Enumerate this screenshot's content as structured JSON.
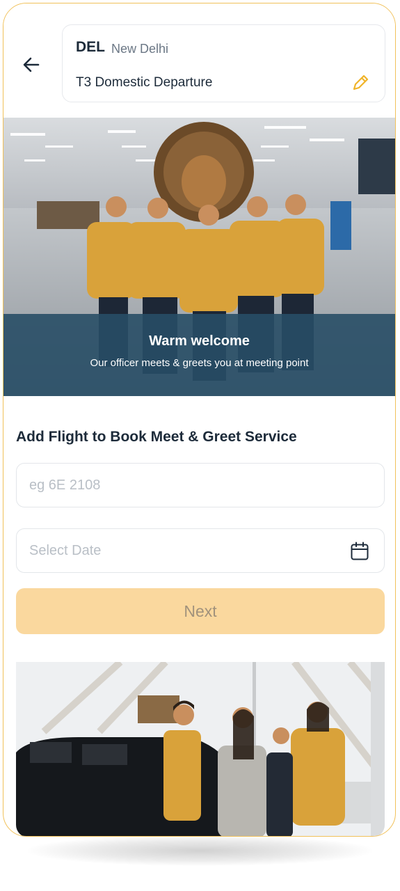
{
  "header": {
    "airport_code": "DEL",
    "city": "New Delhi",
    "terminal": "T3 Domestic Departure"
  },
  "hero": {
    "title": "Warm welcome",
    "subtitle": "Our officer meets & greets you at meeting point"
  },
  "form": {
    "title": "Add Flight to Book Meet & Greet Service",
    "flight_placeholder": "eg 6E 2108",
    "date_placeholder": "Select Date",
    "next_label": "Next"
  },
  "colors": {
    "accent": "#F1C15A",
    "button_disabled_bg": "#FAD89E",
    "caption_overlay": "#284E66",
    "text_dark": "#1D2B3A"
  },
  "icons": {
    "back": "arrow-left-icon",
    "edit": "pencil-icon",
    "calendar": "calendar-icon"
  }
}
